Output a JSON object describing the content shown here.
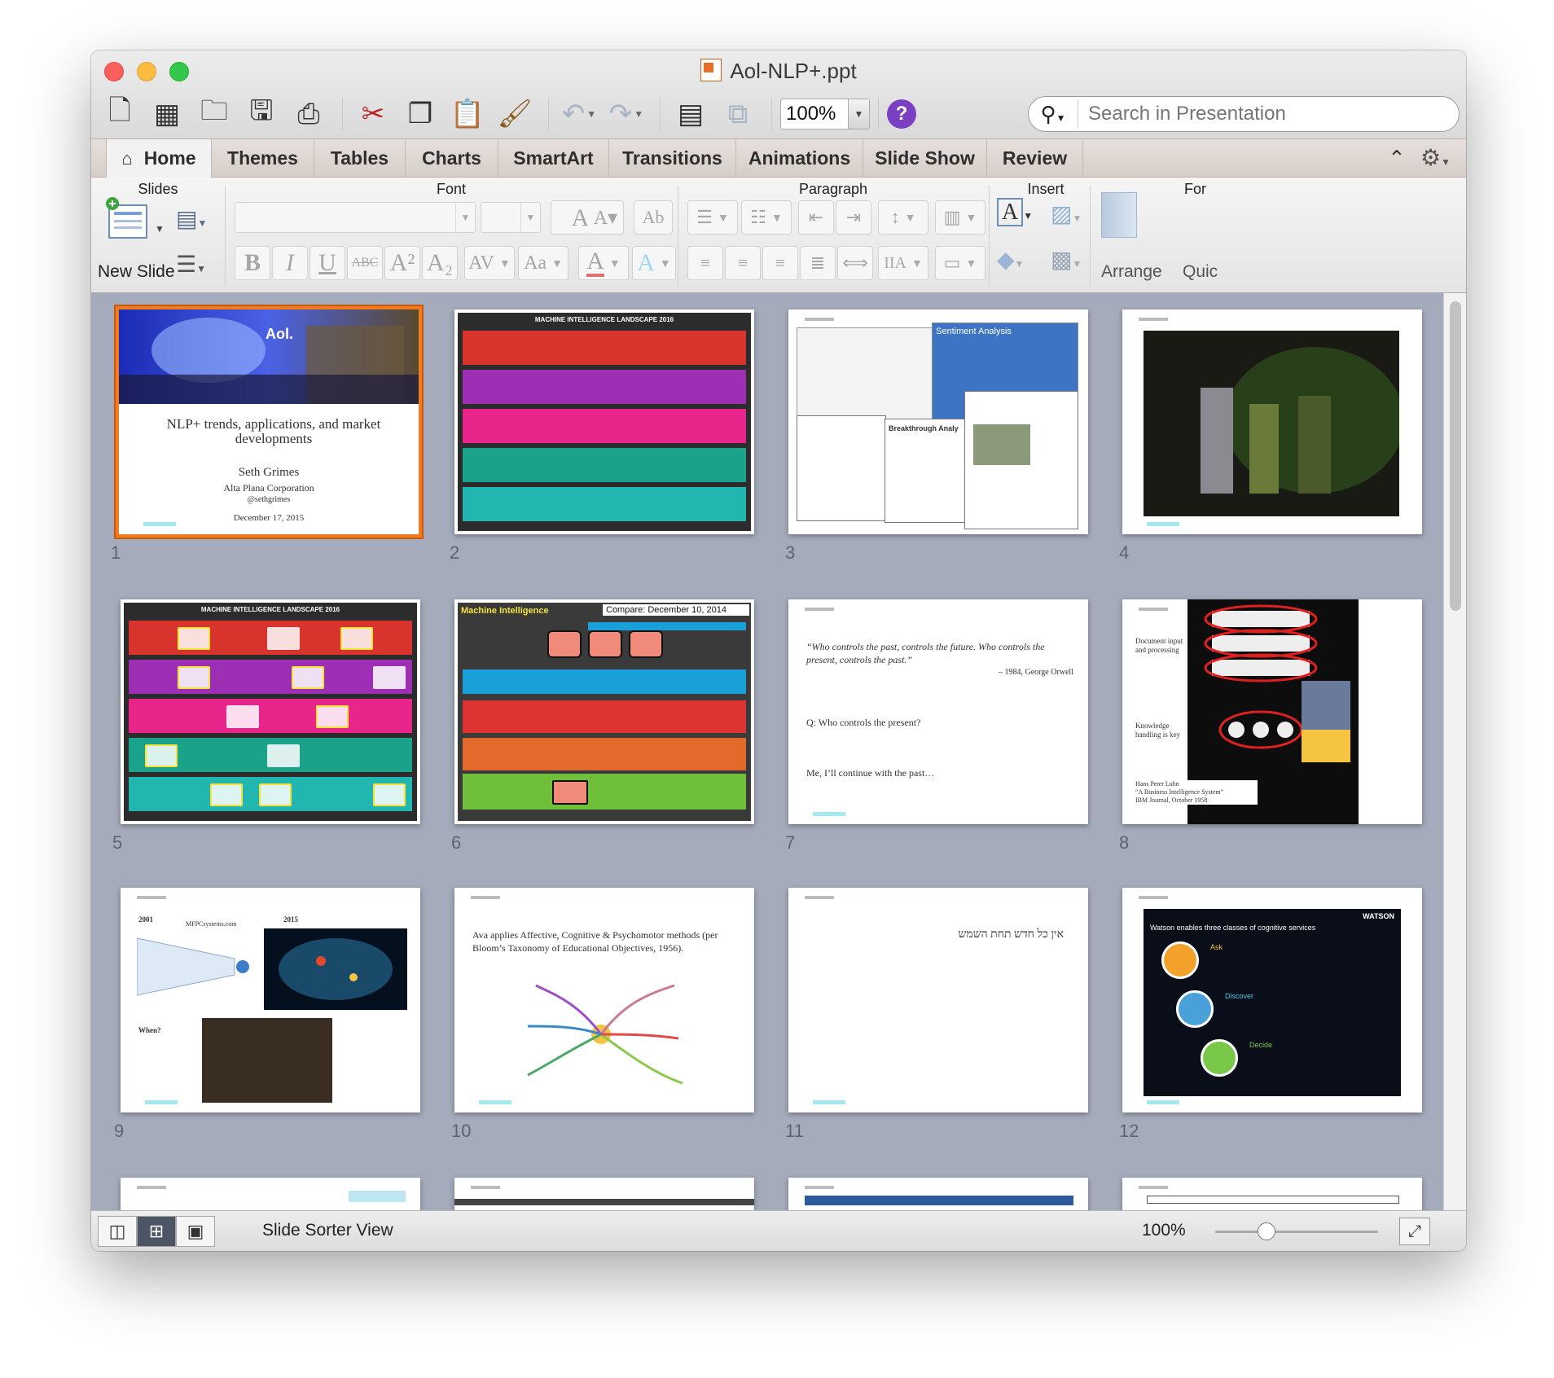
{
  "window": {
    "title": "Aol-NLP+.ppt"
  },
  "toolbar": {
    "zoom": "100%",
    "search_placeholder": "Search in Presentation"
  },
  "tabs": [
    "Home",
    "Themes",
    "Tables",
    "Charts",
    "SmartArt",
    "Transitions",
    "Animations",
    "Slide Show",
    "Review"
  ],
  "ribbon": {
    "groups": [
      "Slides",
      "Font",
      "Paragraph",
      "Insert",
      "For"
    ],
    "new_slide": "New Slide",
    "arrange": "Arrange",
    "quick_styles": "Quic"
  },
  "slides": {
    "s1": {
      "num": "1",
      "title": "NLP+ trends, applications, and market developments",
      "author": "Seth Grimes",
      "org": "Alta Plana Corporation",
      "handle": "@sethgrimes",
      "date": "December 17, 2015",
      "logo": "Aol."
    },
    "s2": {
      "num": "2",
      "header": "MACHINE INTELLIGENCE LANDSCAPE 2016"
    },
    "s3": {
      "num": "3",
      "caption1": "Sentiment Analysis",
      "caption2": "Breakthrough Analy"
    },
    "s4": {
      "num": "4"
    },
    "s5": {
      "num": "5",
      "header": "MACHINE INTELLIGENCE LANDSCAPE 2016"
    },
    "s6": {
      "num": "6",
      "header": "Machine Intelligence",
      "compare": "Compare: December 10, 2014"
    },
    "s7": {
      "num": "7",
      "quote": "“Who controls the past, controls the future. Who controls the present, controls the past.”",
      "attribution": "– 1984, George Orwell",
      "q": "Q: Who controls the present?",
      "a": "Me, I’ll continue with the past…"
    },
    "s8": {
      "num": "8",
      "label1": "Document input and processing",
      "label2": "Knowledge handling is key",
      "citation1": "Hans Peter Luhn",
      "citation2": "“A Business Intelligence System”",
      "citation3": "IBM Journal, October 1958"
    },
    "s9": {
      "num": "9",
      "year1": "2001",
      "year2": "2015",
      "site": "MFPCsystems.com",
      "when": "When?"
    },
    "s10": {
      "num": "10",
      "text": "Ava applies Affective, Cognitive & Psychomotor methods (per Bloom’s Taxonomy of Educational Objectives, 1956)."
    },
    "s11": {
      "num": "11",
      "text": "אין כל חדש תחת השמש"
    },
    "s12": {
      "num": "12",
      "heading": "Watson enables three classes of cognitive services",
      "brand": "WATSON",
      "c1": "Ask",
      "c2": "Discover",
      "c3": "Decide"
    }
  },
  "statusbar": {
    "view": "Slide Sorter View",
    "zoom": "100%"
  },
  "colors": {
    "selection": "#f27a21",
    "sorter_bg": "#a5abbb",
    "help": "#7a3fc2"
  }
}
